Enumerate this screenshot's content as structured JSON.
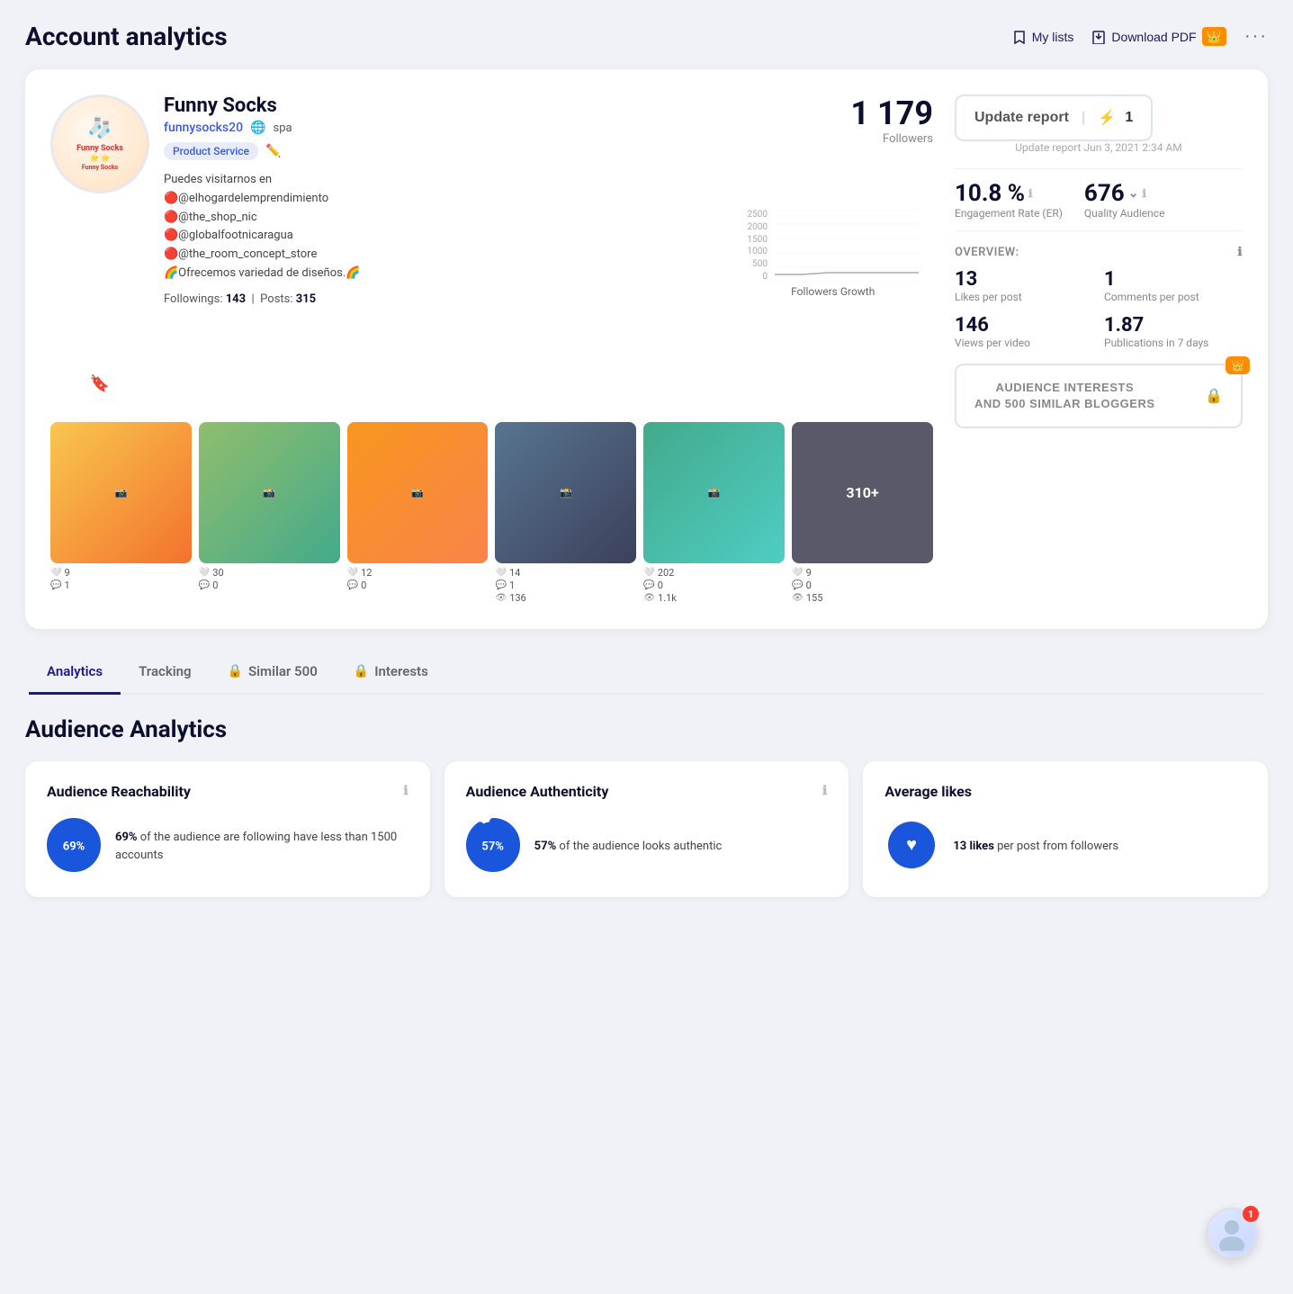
{
  "header": {
    "title": "Account analytics",
    "my_lists_label": "My lists",
    "download_pdf_label": "Download PDF"
  },
  "profile": {
    "name": "Funny Socks",
    "handle": "funnysocks20",
    "language": "spa",
    "tag": "Product Service",
    "followers_count": "1 179",
    "followers_label": "Followers",
    "followings": "143",
    "posts": "315",
    "bio_lines": [
      "Puedes visitarnos en",
      "🔴@elhogardelemprendimiento",
      "🔴@the_shop_nic",
      "🔴@globalfootnicaragua",
      "🔴@the_room_concept_store",
      "🌈Ofrecemos variedad de diseños.🌈"
    ],
    "update_btn_label": "Update report",
    "update_count": "1",
    "update_date": "Update report Jun 3, 2021 2:34 AM",
    "engagement_rate": "10.8 %",
    "engagement_label": "Engagement Rate (ER)",
    "quality_audience": "676",
    "quality_label": "Quality Audience",
    "overview_label": "OVERVIEW:",
    "likes_per_post": "13",
    "likes_per_post_label": "Likes per post",
    "comments_per_post": "1",
    "comments_per_post_label": "Comments per post",
    "views_per_video": "146",
    "views_per_video_label": "Views per video",
    "publications_7d": "1.87",
    "publications_7d_label": "Publications in 7 days",
    "audience_interests_label": "AUDIENCE INTERESTS\nAND 500 SIMILAR BLOGGERS",
    "chart_title": "Followers Growth",
    "chart_y_labels": [
      "2500",
      "2000",
      "1500",
      "1000",
      "500",
      "0"
    ]
  },
  "posts": [
    {
      "bg": "#f9c74f",
      "likes": "9",
      "comments": "1",
      "views": null
    },
    {
      "bg": "#90be6d",
      "likes": "30",
      "comments": "0",
      "views": null
    },
    {
      "bg": "#f8961e",
      "likes": "12",
      "comments": "0",
      "views": null
    },
    {
      "bg": "#577590",
      "likes": "14",
      "comments": "1",
      "views": "136"
    },
    {
      "bg": "#43aa8b",
      "likes": "202",
      "comments": "0",
      "views": "1.1k"
    },
    {
      "bg": "#333",
      "likes": "9",
      "comments": "0",
      "views": "155",
      "more": "310+"
    }
  ],
  "tabs": [
    {
      "id": "analytics",
      "label": "Analytics",
      "active": true,
      "locked": false
    },
    {
      "id": "tracking",
      "label": "Tracking",
      "active": false,
      "locked": false
    },
    {
      "id": "similar500",
      "label": "Similar 500",
      "active": false,
      "locked": true
    },
    {
      "id": "interests",
      "label": "Interests",
      "active": false,
      "locked": true
    }
  ],
  "audience_analytics": {
    "section_title": "Audience Analytics",
    "cards": [
      {
        "id": "reachability",
        "title": "Audience Reachability",
        "percent": "69%",
        "desc_bold": "69%",
        "desc": " of the audience are following have less than 1500 accounts",
        "color": "#1a56db"
      },
      {
        "id": "authenticity",
        "title": "Audience Authenticity",
        "percent": "57%",
        "desc_bold": "57%",
        "desc": " of the audience looks authentic",
        "color": "#1a56db"
      },
      {
        "id": "avg_likes",
        "title": "Average likes",
        "percent": null,
        "desc_bold": "13 likes",
        "desc": " per post from followers",
        "color": "#1a56db"
      }
    ]
  }
}
